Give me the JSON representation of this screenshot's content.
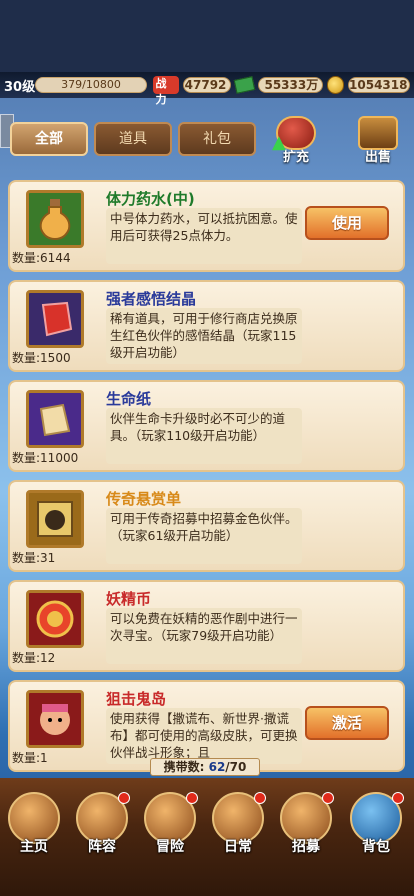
{
  "stats": {
    "level": "30级",
    "exp": "379/10800",
    "power_label": "战力",
    "power": "47792",
    "cash": "55333万",
    "gold": "1054318"
  },
  "tabs": [
    {
      "label": "全部"
    },
    {
      "label": "道具"
    },
    {
      "label": "礼包"
    }
  ],
  "actions": {
    "expand": "扩充",
    "sell": "出售"
  },
  "items": [
    {
      "title": "体力药水(中)",
      "title_color": "#1f7a2a",
      "desc": "中号体力药水，可以抵抗困意。使用后可获得25点体力。",
      "qty": "数量:6144",
      "action": "使用",
      "frame": "#3a7a2a",
      "icon": "potion-icon"
    },
    {
      "title": "强者感悟结晶",
      "title_color": "#2a3a9a",
      "desc": "稀有道具，可用于修行商店兑换原生红色伙伴的感悟结晶（玩家115级开启功能）",
      "qty": "数量:1500",
      "action": "",
      "frame": "#3a2a6a",
      "icon": "crystal-icon"
    },
    {
      "title": "生命纸",
      "title_color": "#2a3a9a",
      "desc": "伙伴生命卡升级时必不可少的道具。（玩家110级开启功能）",
      "qty": "数量:11000",
      "action": "",
      "frame": "#4a2a8a",
      "icon": "paper-icon"
    },
    {
      "title": "传奇悬赏单",
      "title_color": "#d88a1a",
      "desc": "可用于传奇招募中招募金色伙伴。（玩家61级开启功能）",
      "qty": "数量:31",
      "action": "",
      "frame": "#9a6a1a",
      "icon": "wanted-poster-icon"
    },
    {
      "title": "妖精币",
      "title_color": "#c82a2a",
      "desc": "可以免费在妖精的恶作剧中进行一次寻宝。（玩家79级开启功能）",
      "qty": "数量:12",
      "action": "",
      "frame": "#8a1a1a",
      "icon": "fairy-coin-icon"
    },
    {
      "title": "狙击鬼岛",
      "title_color": "#c82a2a",
      "desc": "使用获得【撒谎布、新世界·撒谎布】都可使用的高级皮肤，可更换伙伴战斗形象；且",
      "qty": "数量:1",
      "action": "激活",
      "frame": "#8a1a1a",
      "icon": "avatar-skin-icon"
    }
  ],
  "capacity": {
    "label": "携带数:",
    "used": "62",
    "total": "/70"
  },
  "nav": [
    {
      "label": "主页"
    },
    {
      "label": "阵容"
    },
    {
      "label": "冒险"
    },
    {
      "label": "日常"
    },
    {
      "label": "招募"
    },
    {
      "label": "背包"
    }
  ]
}
